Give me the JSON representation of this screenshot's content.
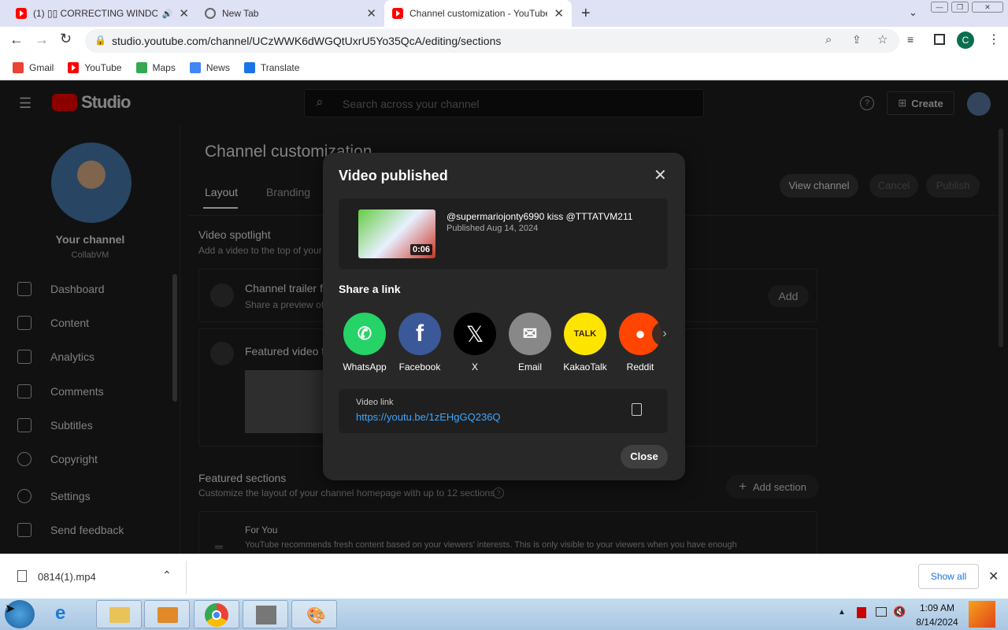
{
  "browser": {
    "tabs": [
      {
        "title": "(1) ▯▯ CORRECTING WINDC",
        "active": false
      },
      {
        "title": "New Tab",
        "active": false
      },
      {
        "title": "Channel customization - YouTube",
        "active": true
      }
    ],
    "url": "studio.youtube.com/channel/UCzWWK6dWGQtUxrU5Yo35QcA/editing/sections",
    "profile_initial": "C",
    "bookmarks": [
      "Gmail",
      "YouTube",
      "Maps",
      "News",
      "Translate"
    ]
  },
  "studio": {
    "logo": "Studio",
    "search_placeholder": "Search across your channel",
    "create_label": "Create",
    "your_channel": "Your channel",
    "channel_sub": "CollabVM",
    "nav": [
      "Dashboard",
      "Content",
      "Analytics",
      "Comments",
      "Subtitles",
      "Copyright",
      "Settings",
      "Send feedback"
    ],
    "page_title": "Channel customization",
    "tabs": [
      "Layout",
      "Branding"
    ],
    "view_channel": "View channel",
    "cancel": "Cancel",
    "publish": "Publish",
    "spotlight_title": "Video spotlight",
    "spotlight_sub": "Add a video to the top of your c",
    "trailer_title": "Channel trailer fo",
    "trailer_sub": "Share a preview of",
    "featured_video_title": "Featured video fo",
    "add": "Add",
    "featured_sections_title": "Featured sections",
    "featured_sections_sub": "Customize the layout of your channel homepage with up to 12 sections",
    "add_section": "Add section",
    "for_you_title": "For You",
    "for_you_sub": "YouTube recommends fresh content based on your viewers' interests. This is only visible to your viewers when you have enough"
  },
  "modal": {
    "title": "Video published",
    "video_title": "@supermariojonty6990 kiss @TTTATVM211",
    "published": "Published Aug 14, 2024",
    "duration": "0:06",
    "share_heading": "Share a link",
    "share_targets": [
      {
        "label": "WhatsApp",
        "color": "#25d366"
      },
      {
        "label": "Facebook",
        "color": "#3b5998"
      },
      {
        "label": "X",
        "color": "#000000"
      },
      {
        "label": "Email",
        "color": "#888888"
      },
      {
        "label": "KakaoTalk",
        "color": "#fee500"
      },
      {
        "label": "Reddit",
        "color": "#ff4500"
      }
    ],
    "kakao_text": "TALK",
    "link_label": "Video link",
    "link_url": "https://youtu.be/1zEHgGQ236Q",
    "close_label": "Close"
  },
  "downloads": {
    "file": "0814(1).mp4",
    "show_all": "Show all"
  },
  "taskbar": {
    "time": "1:09 AM",
    "date": "8/14/2024"
  }
}
